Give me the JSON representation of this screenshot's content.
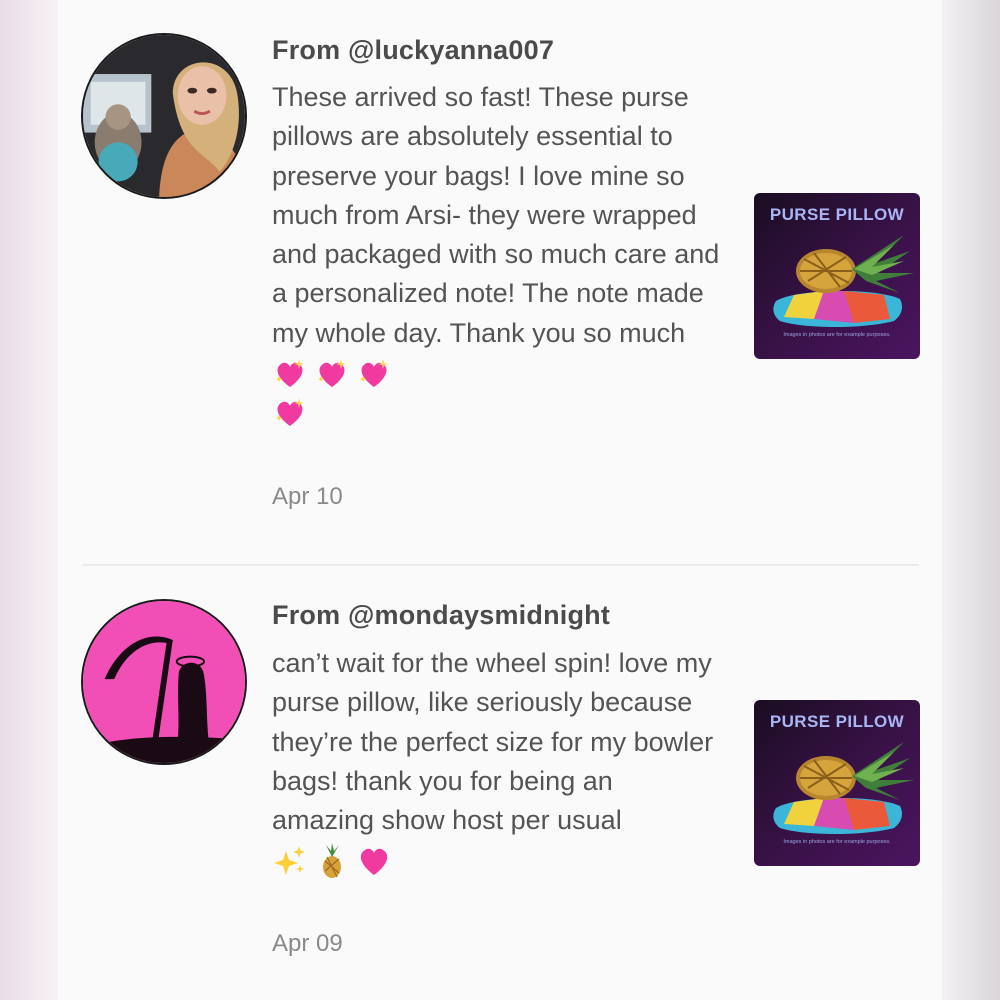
{
  "reviews": [
    {
      "from": "From @luckyanna007",
      "text": "These arrived so fast! These purse pillows are absolutely essential to preserve your bags! I love mine so much from Arsi- they were wrapped and packaged with so much care and a personalized note! The note made my whole day. Thank you so much",
      "emojis": [
        "sparkling-heart",
        "sparkling-heart",
        "sparkling-heart",
        "sparkling-heart"
      ],
      "date": "Apr 10",
      "thumbnail": {
        "title": "PURSE PILLOW",
        "caption": "Images in photos are for example purposes."
      }
    },
    {
      "from": "From @mondaysmidnight",
      "text": "can’t wait for the wheel spin! love my purse pillow, like seriously because they’re the perfect size for my bowler bags! thank you for being an amazing show host per usual",
      "emojis": [
        "sparkles",
        "pineapple",
        "pink-heart"
      ],
      "date": "Apr 09",
      "thumbnail": {
        "title": "PURSE PILLOW",
        "caption": "Images in photos are for example purposes."
      }
    }
  ],
  "colors": {
    "text": "#545454",
    "heading": "#4b4b4b",
    "date": "#8a8a8a",
    "thumb_bg": "#3a1248",
    "accent_pink": "#f13aa0"
  }
}
